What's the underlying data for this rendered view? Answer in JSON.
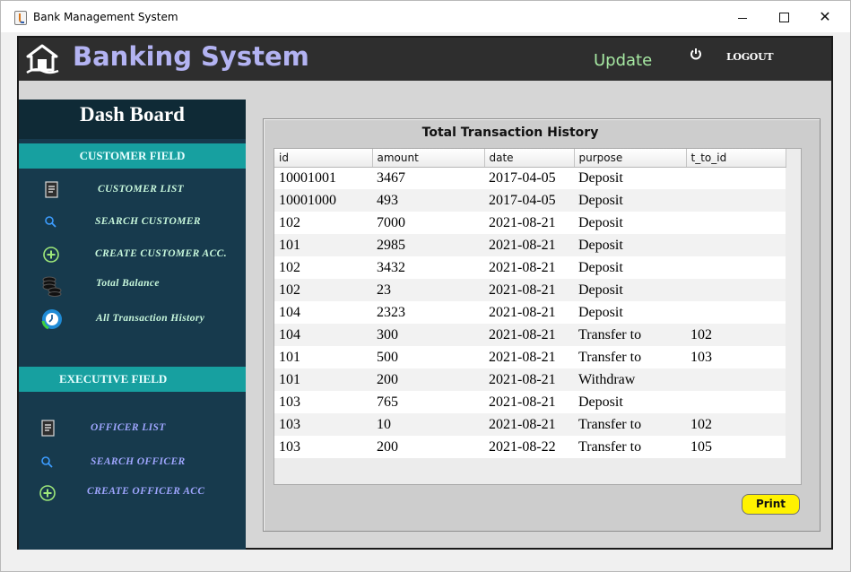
{
  "window": {
    "title": "Bank Management System"
  },
  "header": {
    "brand": "Banking System",
    "update_label": "Update",
    "logout_label": "LOGOUT"
  },
  "sidebar": {
    "title": "Dash Board",
    "customer_section": "CUSTOMER FIELD",
    "customer_items": [
      {
        "label": "CUSTOMER LIST",
        "icon": "document-icon"
      },
      {
        "label": "SEARCH CUSTOMER",
        "icon": "search-icon"
      },
      {
        "label": "CREATE CUSTOMER ACC.",
        "icon": "plus-circle-icon"
      },
      {
        "label": "Total Balance",
        "icon": "coins-icon"
      },
      {
        "label": "All Transaction History",
        "icon": "history-clock-icon"
      }
    ],
    "executive_section": "EXECUTIVE FIELD",
    "officer_items": [
      {
        "label": "OFFICER LIST",
        "icon": "document-icon"
      },
      {
        "label": "SEARCH OFFICER",
        "icon": "search-icon"
      },
      {
        "label": "CREATE OFFICER ACC",
        "icon": "plus-circle-icon"
      }
    ]
  },
  "main": {
    "title": "Total Transaction History",
    "columns": [
      "id",
      "amount",
      "date",
      "purpose",
      "t_to_id"
    ],
    "rows": [
      [
        "10001001",
        "3467",
        "2017-04-05",
        "Deposit",
        ""
      ],
      [
        "10001000",
        "493",
        "2017-04-05",
        "Deposit",
        ""
      ],
      [
        "102",
        "7000",
        "2021-08-21",
        "Deposit",
        ""
      ],
      [
        "101",
        "2985",
        "2021-08-21",
        "Deposit",
        ""
      ],
      [
        "102",
        "3432",
        "2021-08-21",
        "Deposit",
        ""
      ],
      [
        "102",
        "23",
        "2021-08-21",
        "Deposit",
        ""
      ],
      [
        "104",
        "2323",
        "2021-08-21",
        "Deposit",
        ""
      ],
      [
        "104",
        "300",
        "2021-08-21",
        "Transfer to",
        "102"
      ],
      [
        "101",
        "500",
        "2021-08-21",
        "Transfer to",
        "103"
      ],
      [
        "101",
        "200",
        "2021-08-21",
        "Withdraw",
        ""
      ],
      [
        "103",
        "765",
        "2021-08-21",
        "Deposit",
        ""
      ],
      [
        "103",
        "10",
        "2021-08-21",
        "Transfer to",
        "102"
      ],
      [
        "103",
        "200",
        "2021-08-22",
        "Transfer to",
        "105"
      ]
    ],
    "print_label": "Print"
  },
  "colors": {
    "header_bg": "#2e2e2e",
    "brand_text": "#b3b3f2",
    "update_text": "#a6e8a2",
    "sidebar_bg": "#173a4d",
    "section_bg": "#17a0a0",
    "print_btn": "#fff200"
  }
}
